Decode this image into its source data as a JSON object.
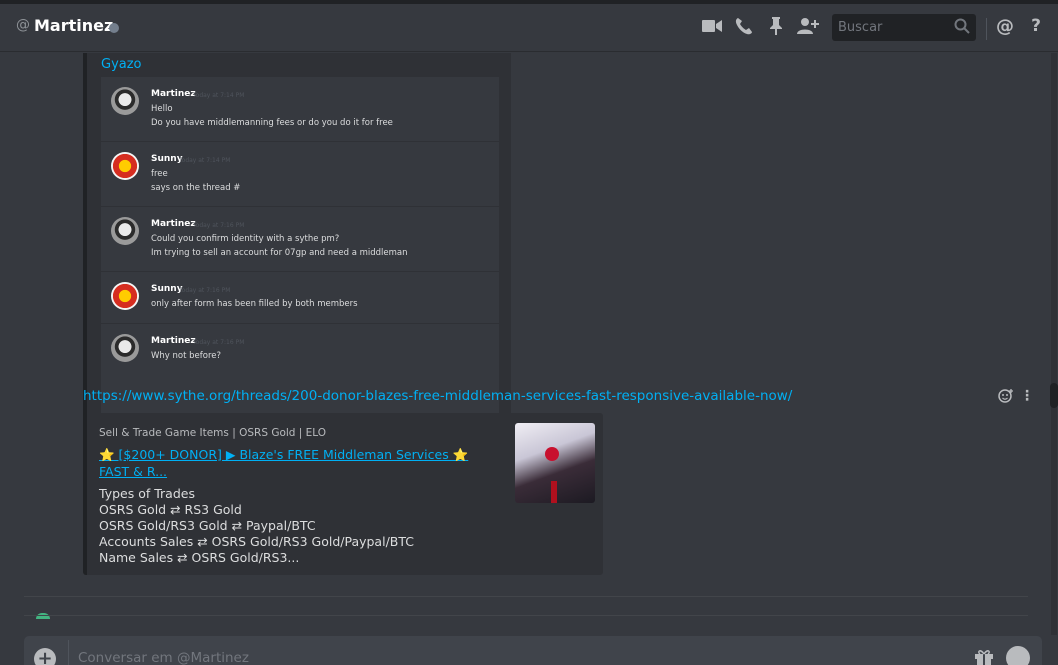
{
  "header": {
    "at_symbol": "@",
    "channel_name": "Martinez",
    "search_placeholder": "Buscar",
    "icons": [
      "video-call-icon",
      "phone-call-icon",
      "pin-icon",
      "add-friend-icon",
      "search-icon",
      "mention-icon",
      "help-icon"
    ]
  },
  "embed": {
    "provider": "Gyazo",
    "messages": [
      {
        "author": "Martinez",
        "time": "Today at 7:14 PM",
        "lines": [
          "Hello",
          "Do you have middlemanning fees or do you do it for free"
        ]
      },
      {
        "author": "Sunny",
        "time": "Today at 7:14 PM",
        "lines": [
          "free",
          "says on the thread #"
        ]
      },
      {
        "author": "Martinez",
        "time": "Today at 7:16 PM",
        "lines": [
          "Could you confirm identity with a sythe pm?",
          "Im trying to sell an account for 07gp and need a middleman"
        ]
      },
      {
        "author": "Sunny",
        "time": "Today at 7:16 PM",
        "lines": [
          "only after form has been filled by both members"
        ]
      },
      {
        "author": "Martinez",
        "time": "Today at 7:16 PM",
        "lines": [
          "Why not before?"
        ]
      }
    ]
  },
  "link": {
    "url": "https://www.sythe.org/threads/200-donor-blazes-free-middleman-services-fast-responsive-available-now/"
  },
  "link_embed": {
    "provider": "Sell & Trade Game Items | OSRS Gold | ELO",
    "title": "⭐ [$200+ DONOR] ▶ Blaze's FREE Middleman Services ⭐ FAST & R...",
    "description_lines": [
      "Types of Trades",
      "OSRS Gold ⇄ RS3 Gold",
      "OSRS Gold/RS3 Gold ⇄ Paypal/BTC",
      "Accounts Sales ⇄ OSRS Gold/RS3 Gold/Paypal/BTC",
      "Name Sales ⇄ OSRS Gold/RS3..."
    ]
  },
  "composer": {
    "placeholder": "Conversar em @Martinez"
  },
  "colors": {
    "background": "#36393f",
    "link": "#00b0f4",
    "embed_bg": "#2f3136",
    "online": "#43b581"
  }
}
